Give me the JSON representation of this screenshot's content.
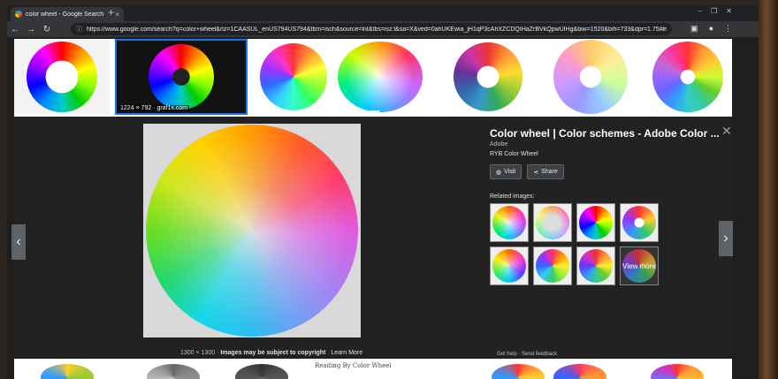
{
  "browser": {
    "tab_title": "color wheel - Google Search",
    "tab_close": "×",
    "new_tab": "+",
    "url": "https://www.google.com/search?q=color+wheel&rlz=1CAASUL_enUS794US794&tbm=isch&source=lnt&tbs=isz:l&sa=X&ved=0ahUKEwia_jH1qP3cAhXZCDQIHaZrBVkQpwUIHg&biw=1520&bih=733&dpr=1.75#imgrc=yd4jlx-5y7U_RM:",
    "nav_back": "←",
    "nav_forward": "→",
    "nav_reload": "↻",
    "lock": "ⓘ",
    "star": "☆",
    "win_min": "–",
    "win_max": "❐",
    "win_close": "✕"
  },
  "thumbnails": {
    "selected_caption": "1224 × 792 · graf1x.com"
  },
  "preview": {
    "title": "Color wheel | Color schemes - Adobe Color ...",
    "source": "Adobe",
    "subtitle": "RYB Color Wheel",
    "visit_label": "Visit",
    "share_label": "Share",
    "related_label": "Related images:",
    "view_more_label": "View more",
    "image_size": "1300 × 1300",
    "copyright_note": "Images may be subject to copyright",
    "learn_more": "Learn More",
    "get_help": "Get help",
    "send_feedback": "Send feedback",
    "close": "✕",
    "prev": "‹",
    "next": "›"
  },
  "bottom_strip": {
    "caption": "Reading By Color Wheel"
  },
  "colors": {
    "accent_blue": "#1a73e8",
    "panel_bg": "#222222",
    "toolbar_bg": "#35363a"
  }
}
